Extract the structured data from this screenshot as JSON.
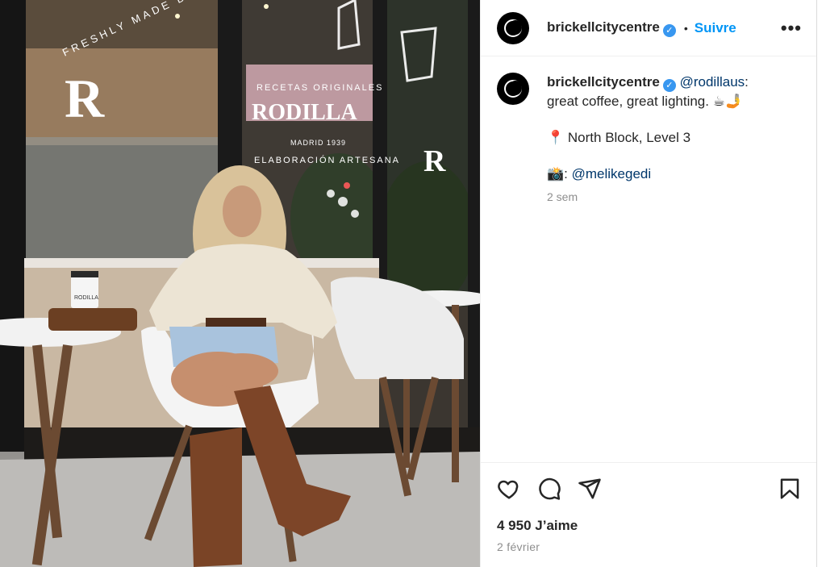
{
  "post": {
    "account": "brickellcitycentre",
    "verified_badge": "✓",
    "separator": "•",
    "follow_label": "Suivre",
    "more_label": "•••"
  },
  "photo": {
    "signage_left": "FRESHLY MADE DAILY",
    "signage_left_letter": "R",
    "signage_center_top": "RECETAS ORIGINALES",
    "signage_center_brand": "RODILLA",
    "signage_center_sub": "MADRID 1939",
    "signage_center_bottom": "ELABORACIÓN ARTESANA",
    "signage_right_letter": "R",
    "cup_label": "RODILLA"
  },
  "caption": {
    "user": "brickellcitycentre",
    "mention": "@rodillaus",
    "text_after_mention": ":",
    "line1": "great coffee, great lighting. ☕🤳",
    "location_pin": "📍",
    "location": " North Block, Level 3",
    "camera": "📸",
    "credit_prefix": ": ",
    "credit": "@melikegedi",
    "time": "2 sem"
  },
  "stats": {
    "likes": "4 950 J’aime",
    "date": "2 février"
  },
  "colors": {
    "accent": "#0095f6",
    "verified": "#3897f0",
    "mention": "#00376b",
    "muted": "#8e8e8e"
  },
  "icons": [
    "heart-icon",
    "comment-icon",
    "share-icon",
    "bookmark-icon",
    "more-icon"
  ]
}
